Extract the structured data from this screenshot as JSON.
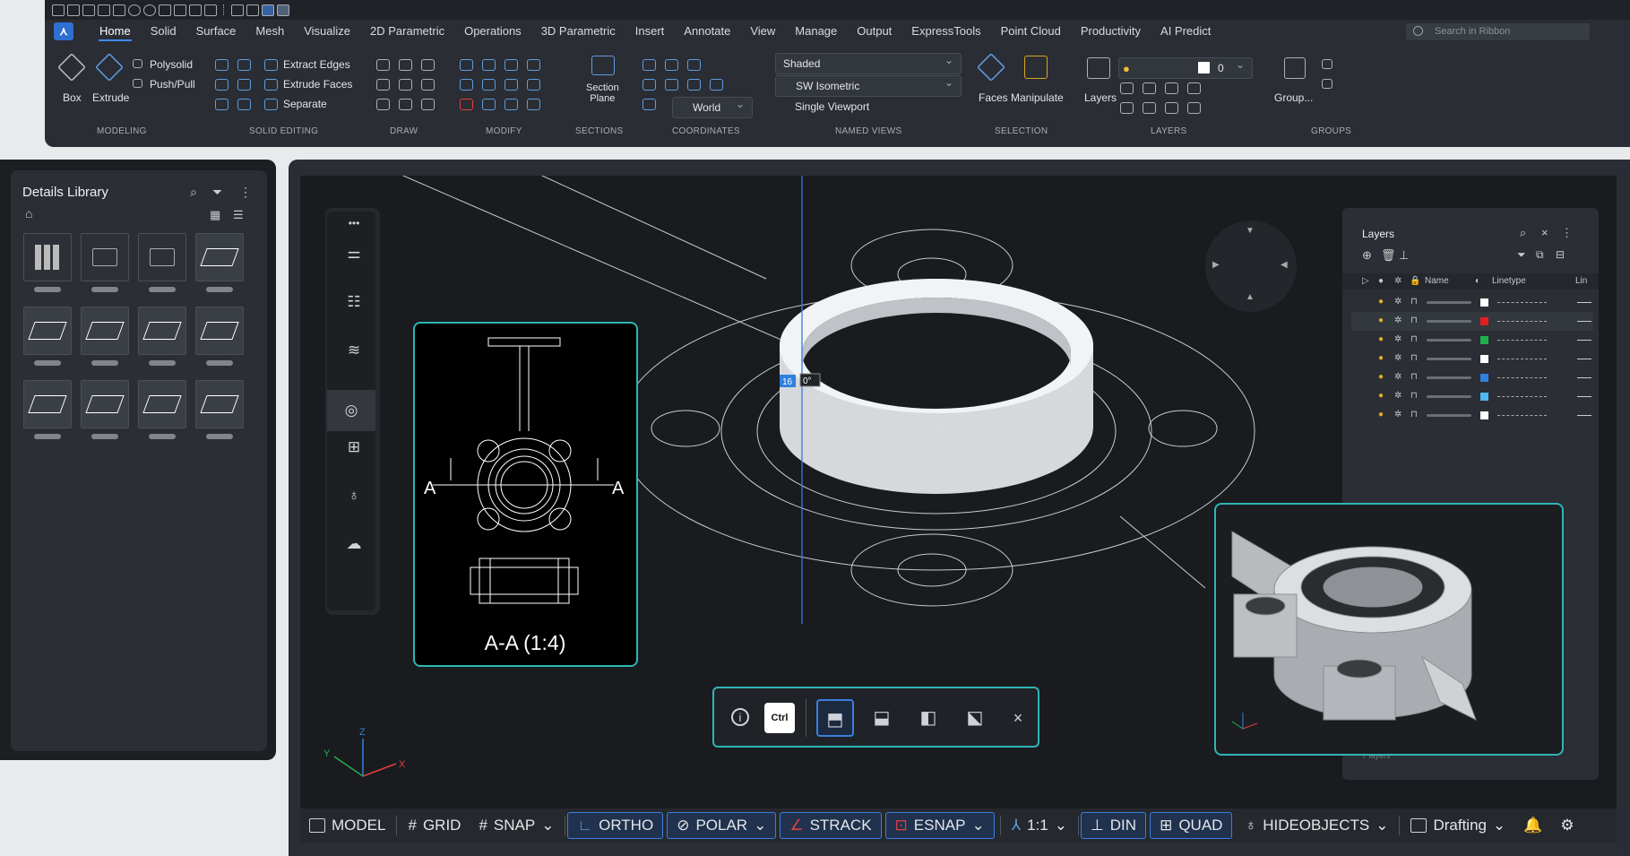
{
  "ribbon": {
    "tabs": [
      "Home",
      "Solid",
      "Surface",
      "Mesh",
      "Visualize",
      "2D Parametric",
      "Operations",
      "3D Parametric",
      "Insert",
      "Annotate",
      "View",
      "Manage",
      "Output",
      "ExpressTools",
      "Point Cloud",
      "Productivity",
      "AI Predict"
    ],
    "active_tab": "Home",
    "search_placeholder": "Search in Ribbon",
    "modeling": {
      "box": "Box",
      "extrude": "Extrude",
      "polysolid": "Polysolid",
      "pushpull": "Push/Pull",
      "label": "MODELING"
    },
    "solid_editing": {
      "extract_edges": "Extract Edges",
      "extrude_faces": "Extrude Faces",
      "separate": "Separate",
      "label": "SOLID EDITING"
    },
    "draw": {
      "label": "DRAW"
    },
    "modify": {
      "label": "MODIFY"
    },
    "sections": {
      "section_plane": "Section\nPlane",
      "label": "SECTIONS"
    },
    "coordinates": {
      "world": "World",
      "label": "COORDINATES"
    },
    "named_views": {
      "visual_style": "Shaded",
      "view": "SW Isometric",
      "viewport": "Single Viewport",
      "label": "NAMED VIEWS"
    },
    "selection": {
      "faces": "Faces",
      "manipulate": "Manipulate",
      "label": "SELECTION"
    },
    "layers": {
      "layers": "Layers",
      "current": "0",
      "label": "LAYERS"
    },
    "groups": {
      "group": "Group...",
      "label": "GROUPS"
    }
  },
  "library": {
    "title": "Details Library"
  },
  "viewport": {
    "section_label": "A-A (1:4)",
    "section_letter_left": "A",
    "section_letter_right": "A",
    "dim_input": "16",
    "angle_input": "0°",
    "axis_x": "X",
    "axis_y": "Y",
    "axis_z": "Z"
  },
  "layers_panel": {
    "title": "Layers",
    "col_name": "Name",
    "col_linetype": "Linetype",
    "col_lin": "Lin",
    "rows": [
      {
        "color": "#ffffff"
      },
      {
        "color": "#e02020"
      },
      {
        "color": "#20b050"
      },
      {
        "color": "#ffffff"
      },
      {
        "color": "#2f7fe0"
      },
      {
        "color": "#4fb8f0"
      },
      {
        "color": "#ffffff"
      }
    ],
    "footer": "7 layers"
  },
  "toolbar": {
    "ctrl": "Ctrl",
    "info": "i",
    "close": "×"
  },
  "status": {
    "model": "MODEL",
    "grid": "GRID",
    "snap": "SNAP",
    "ortho": "ORTHO",
    "polar": "POLAR",
    "strack": "STRACK",
    "esnap": "ESNAP",
    "scale": "1:1",
    "din": "DIN",
    "quad": "QUAD",
    "hideobjects": "HIDEOBJECTS",
    "workspace": "Drafting"
  }
}
